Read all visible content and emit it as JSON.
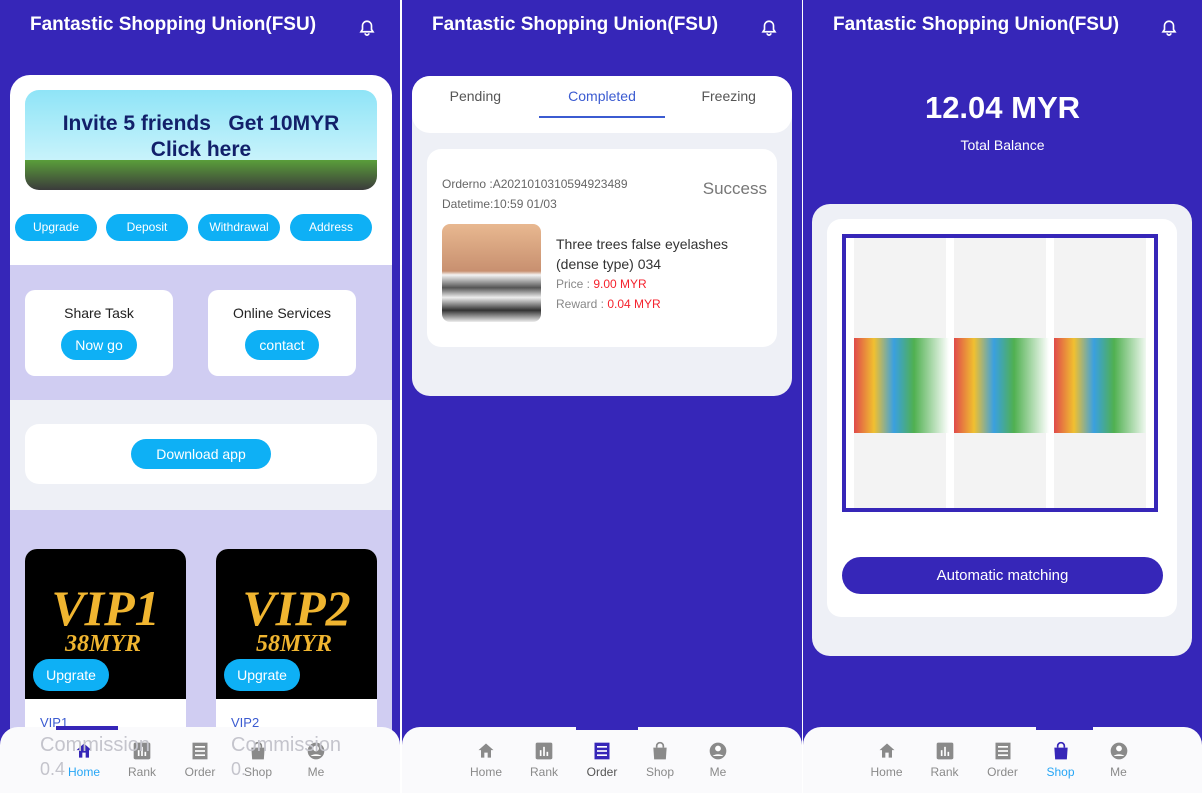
{
  "app_title": "Fantastic Shopping Union(FSU)",
  "nav": [
    "Home",
    "Rank",
    "Order",
    "Shop",
    "Me"
  ],
  "home": {
    "banner": {
      "line1": "Invite 5 friends   Get 10MYR",
      "line2": "Click here"
    },
    "actions": [
      "Upgrade",
      "Deposit",
      "Withdrawal",
      "Address"
    ],
    "share_task": {
      "title": "Share Task",
      "button": "Now go"
    },
    "online_services": {
      "title": "Online Services",
      "button": "contact"
    },
    "download": "Download app",
    "vips": [
      {
        "logo": "VIP1",
        "price": "38MYR",
        "button": "Upgrate",
        "name": "VIP1",
        "commission": "Commission",
        "rate": "0.4"
      },
      {
        "logo": "VIP2",
        "price": "58MYR",
        "button": "Upgrate",
        "name": "VIP2",
        "commission": "Commission",
        "rate": "0."
      }
    ]
  },
  "order": {
    "tabs": [
      "Pending",
      "Completed",
      "Freezing"
    ],
    "active_tab": "Completed",
    "item": {
      "orderno": "Orderno :A2021010310594923489",
      "datetime": "Datetime:10:59 01/03",
      "status": "Success",
      "title": "Three trees false eyelashes (dense type) 034",
      "price_label": "Price : ",
      "price": "9.00 MYR",
      "reward_label": "Reward : ",
      "reward": "0.04 MYR"
    }
  },
  "shop": {
    "balance": "12.04 MYR",
    "balance_label": "Total Balance",
    "button": "Automatic matching"
  },
  "colors": {
    "brand": "#3626b8",
    "accent": "#0eb0f5",
    "lavender": "#d0cdf2",
    "price": "#f5222d"
  }
}
